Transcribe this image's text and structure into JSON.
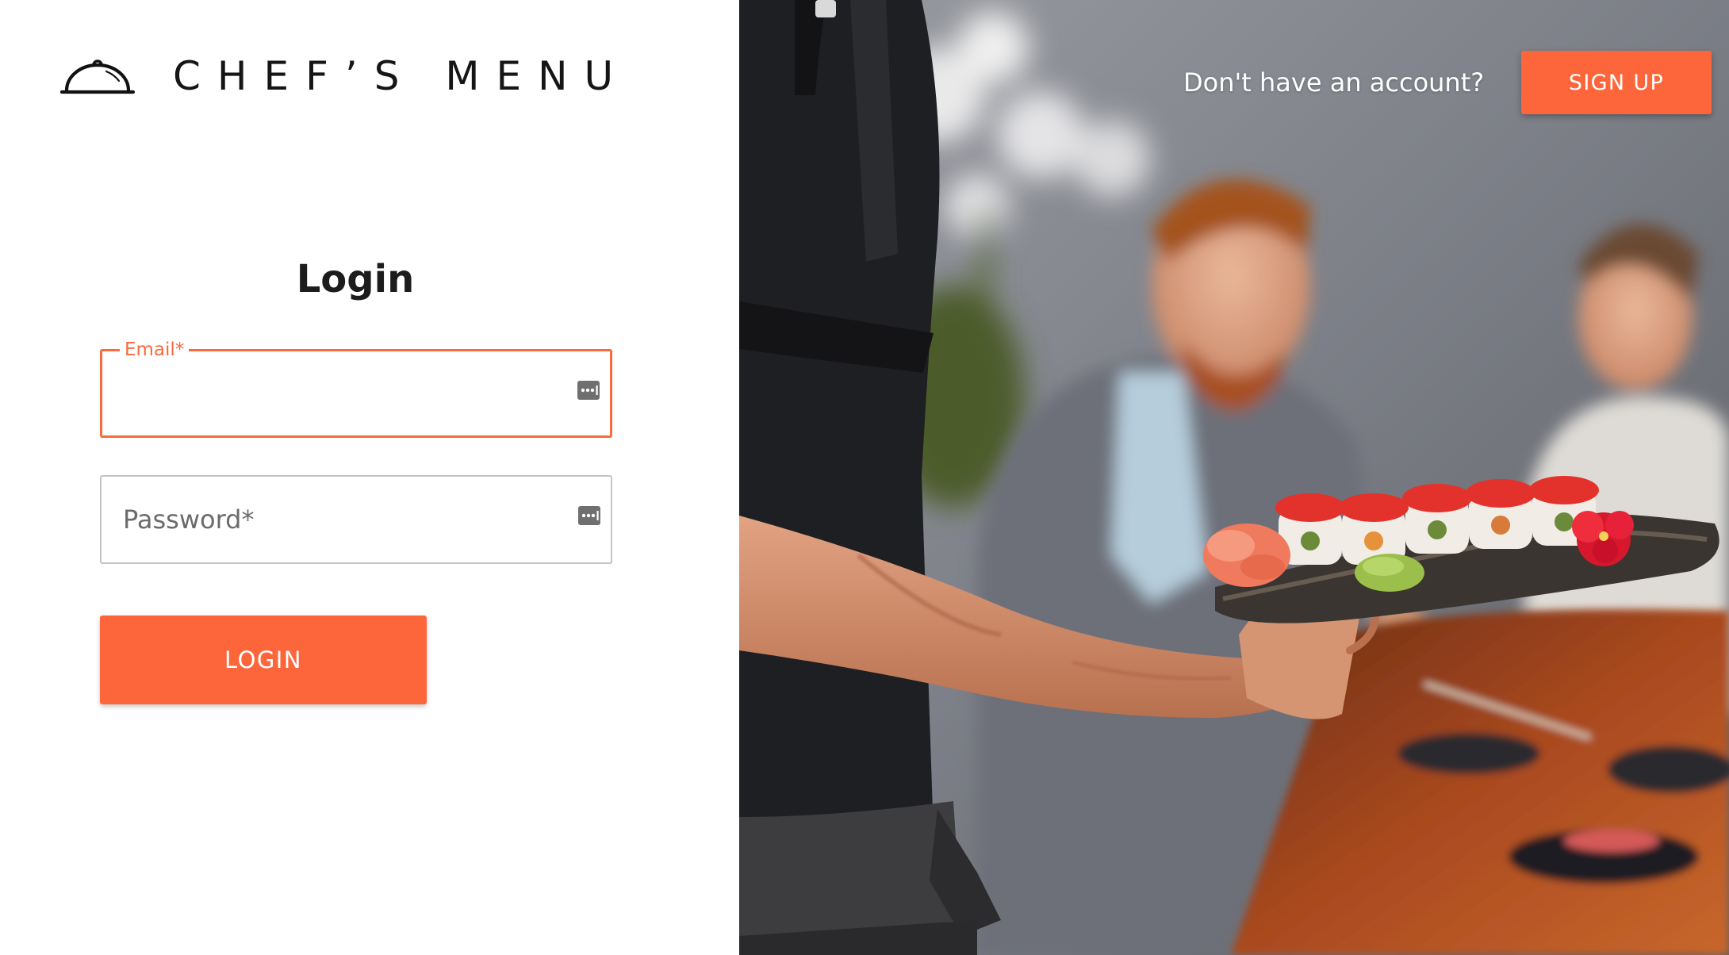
{
  "brand": {
    "name": "CHEF’S MENU",
    "logo_icon": "cloche-icon"
  },
  "login_form": {
    "title": "Login",
    "email": {
      "label": "Email",
      "required_marker": "*",
      "value": "",
      "focused": true,
      "trailing_icon": "password-manager-autofill-icon"
    },
    "password": {
      "label": "Password",
      "required_marker": "*",
      "value": "",
      "focused": false,
      "trailing_icon": "password-manager-autofill-icon"
    },
    "submit_label": "LOGIN"
  },
  "header": {
    "account_prompt": "Don't have an account?",
    "signup_label": "SIGN UP"
  },
  "hero_image": {
    "subject": "waiter-holding-sushi-platter-restaurant"
  },
  "colors": {
    "accent": "#fd663a",
    "focus_border": "#fa6a3c",
    "text_primary": "#1c1c1c",
    "input_border": "#c4c4c4",
    "placeholder": "#6b6b6b",
    "background": "#ffffff"
  }
}
